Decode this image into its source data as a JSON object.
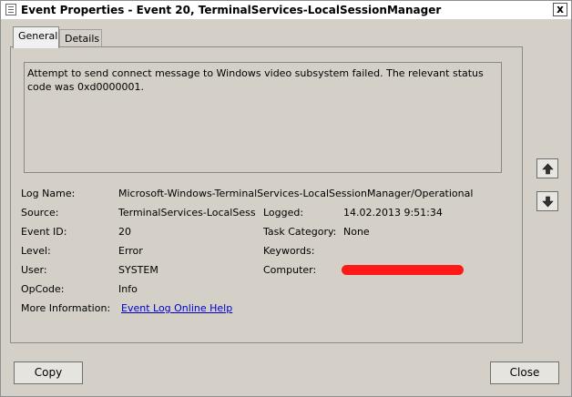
{
  "window": {
    "title": "Event Properties - Event 20, TerminalServices-LocalSessionManager",
    "close_glyph": "x"
  },
  "tabs": [
    {
      "label": "General",
      "active": true
    },
    {
      "label": "Details",
      "active": false
    }
  ],
  "event": {
    "description": "Attempt to send connect message to Windows video subsystem failed. The relevant status code was 0xd0000001.",
    "log_name_label": "Log Name:",
    "log_name": "Microsoft-Windows-TerminalServices-LocalSessionManager/Operational",
    "source_label": "Source:",
    "source": "TerminalServices-LocalSessionManager",
    "logged_label": "Logged:",
    "logged": "14.02.2013 9:51:34",
    "event_id_label": "Event ID:",
    "event_id": "20",
    "task_category_label": "Task Category:",
    "task_category": "None",
    "level_label": "Level:",
    "level": "Error",
    "keywords_label": "Keywords:",
    "keywords": "",
    "user_label": "User:",
    "user": "SYSTEM",
    "computer_label": "Computer:",
    "opcode_label": "OpCode:",
    "opcode": "Info",
    "more_info_label": "More Information:",
    "more_info_link": "Event Log Online Help"
  },
  "buttons": {
    "copy": "Copy",
    "close": "Close"
  },
  "icons": {
    "up": "arrow-up-icon",
    "down": "arrow-down-icon"
  },
  "colors": {
    "redaction": "#ff1a1a",
    "link": "#0000cc"
  }
}
